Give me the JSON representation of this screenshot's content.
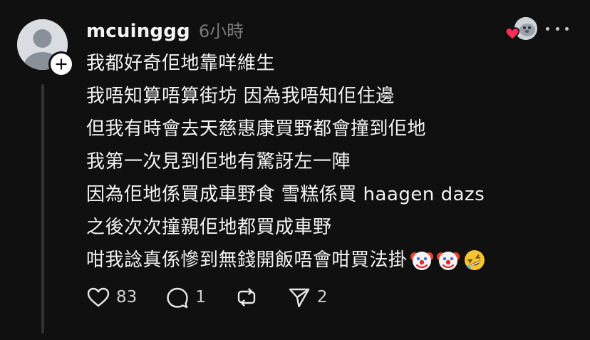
{
  "post": {
    "username": "mcuinggg",
    "timestamp": "6小時",
    "lines": [
      "我都好奇佢地靠咩維生",
      "我唔知算唔算街坊 因為我唔知佢住邊",
      "但我有時會去天慈惠康買野都會撞到佢地",
      "我第一次見到佢地有驚訝左一陣",
      "因為佢地係買成車野食 雪糕係買 haagen dazs",
      "之後次次撞親佢地都買成車野",
      "咁我諗真係慘到無錢開飯唔會咁買法掛"
    ],
    "trailing_emojis": [
      "clown-face-emoji",
      "clown-face-emoji",
      "rolling-on-floor-laughing-emoji"
    ]
  },
  "actions": {
    "like_count": "83",
    "reply_count": "1",
    "repost_count": "",
    "share_count": "2"
  },
  "icons": {
    "like": "heart-icon",
    "reply": "comment-bubble-icon",
    "repost": "repost-icon",
    "share": "send-icon",
    "more": "more-icon",
    "follow": "plus-icon"
  },
  "colors": {
    "background": "#101010",
    "text": "#f3f3f3",
    "muted": "#7a7a7a",
    "heart": "#ff2d55"
  }
}
